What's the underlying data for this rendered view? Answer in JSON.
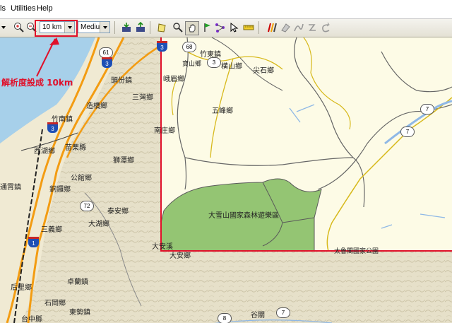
{
  "menu": {
    "items": [
      "ls",
      "Utilities",
      "Help"
    ]
  },
  "toolbar": {
    "resolution_value": "10 km",
    "detail_value": "Medium"
  },
  "annotation": {
    "text": "解析度設成 10km",
    "color": "#e0102a"
  },
  "map": {
    "region_labels": [
      "竹東鎮",
      "寶山鄉",
      "橫山鄉",
      "尖石鄉",
      "峨眉鄉",
      "頭份鎮",
      "三灣鄉",
      "造橋鄉",
      "五峰鄉",
      "南庄鄉",
      "竹南鎮",
      "西湖鄉",
      "苗栗縣",
      "獅潭鄉",
      "公館鄉",
      "銅鑼鄉",
      "通霄鎮",
      "泰安鄉",
      "大湖鄉",
      "三義鄉",
      "大雪山國家森林遊樂區",
      "大安溪",
      "太魯閣國家公園",
      "卓蘭鎮",
      "后里鄉",
      "石岡鄉",
      "東勢鎮",
      "台中縣",
      "大安鄉",
      "谷關"
    ],
    "route_shields": [
      "61",
      "3",
      "68",
      "3",
      "72",
      "7",
      "7",
      "7",
      "8"
    ],
    "freeway_shields": [
      "3",
      "3",
      "1",
      "3"
    ],
    "colors": {
      "terrain": "#e6e0c9",
      "lowres": "#fdfbe6",
      "forest": "#94c573",
      "border": "#e0102a"
    }
  }
}
